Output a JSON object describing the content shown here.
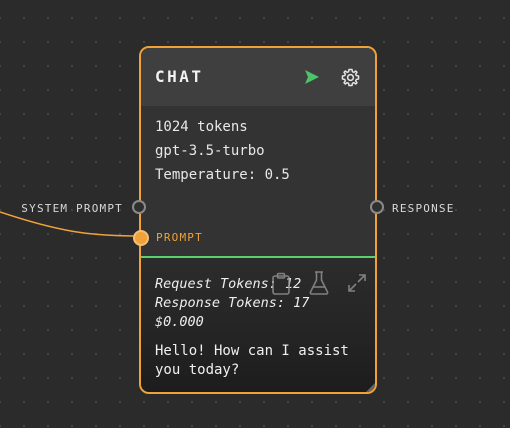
{
  "node": {
    "title": "CHAT",
    "model_info": {
      "tokens": "1024 tokens",
      "model": "gpt-3.5-turbo",
      "temperature": "Temperature: 0.5"
    },
    "inputs": {
      "system_prompt": "SYSTEM PROMPT",
      "prompt": "PROMPT"
    },
    "outputs": {
      "response": "RESPONSE"
    },
    "result": {
      "request_tokens": "Request Tokens: 12",
      "response_tokens": "Response Tokens: 17",
      "cost": "$0.000",
      "text": "Hello! How can I assist you today?"
    },
    "icons": {
      "run": "send-icon",
      "settings": "gear-icon",
      "copy": "clipboard-icon",
      "test": "flask-icon",
      "expand": "expand-icon",
      "resize": "resize-handle-icon"
    }
  },
  "colors": {
    "canvas_background": "#2b2b2b",
    "node_border": "#f0a238",
    "node_header": "#3f3f3f",
    "node_body": "#333333",
    "success_divider": "#5bd16b",
    "run_icon": "#4cc46a",
    "wire": "#f0a238",
    "inactive_port": "#8a8a8a"
  }
}
